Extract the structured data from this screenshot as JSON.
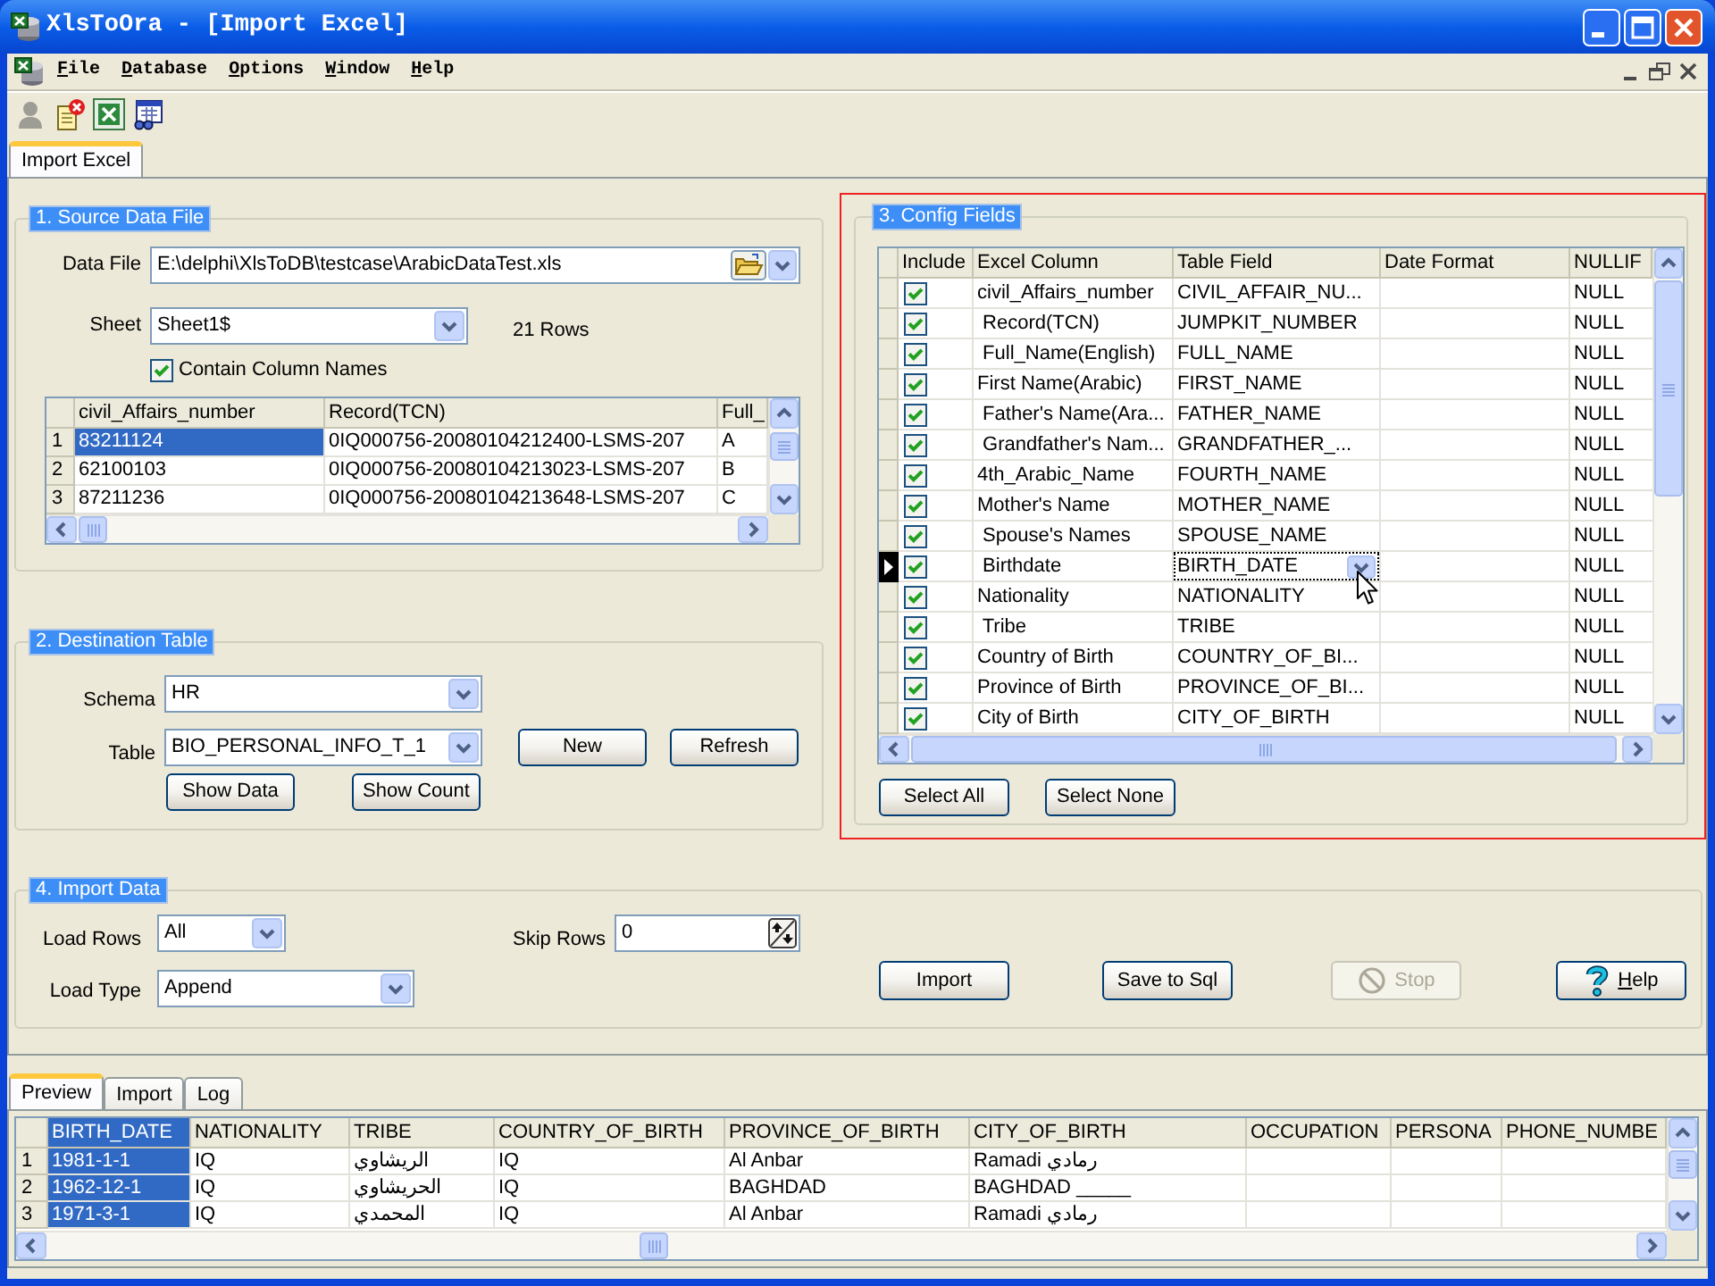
{
  "window": {
    "title": "XlsToOra - [Import Excel]"
  },
  "menu": [
    "File",
    "Database",
    "Options",
    "Window",
    "Help"
  ],
  "toolbar": [
    {
      "disabled": true
    },
    {
      "disabled": false
    },
    {
      "disabled": false
    },
    {
      "disabled": false
    }
  ],
  "tabs": [
    {
      "label": "Import Excel",
      "selected": true
    }
  ],
  "source_data_file": {
    "title": "1. Source Data File",
    "data_file": {
      "label": "Data File",
      "value": "E:\\delphi\\XlsToDB\\testcase\\ArabicDataTest.xls"
    },
    "sheet": {
      "label": "Sheet",
      "value": "Sheet1$"
    },
    "row_count": "21 Rows",
    "contain_column_names": {
      "label": "Contain Column Names",
      "checked": true
    },
    "grid": {
      "columns": [
        {
          "label": "civil_Affairs_number",
          "selected": true
        },
        {
          "label": "Record(TCN)",
          "selected": false
        },
        {
          "label": "Full_",
          "selected": false
        }
      ],
      "rows": [
        {
          "number": "1",
          "selected": true,
          "cells": [
            "83211124",
            "0IQ000756-20080104212400-LSMS-207",
            "A"
          ]
        },
        {
          "number": "2",
          "selected": false,
          "cells": [
            "62100103",
            "0IQ000756-20080104213023-LSMS-207",
            "B"
          ]
        },
        {
          "number": "3",
          "selected": false,
          "cells": [
            "87211236",
            "0IQ000756-20080104213648-LSMS-207",
            "C"
          ]
        }
      ]
    }
  },
  "destination_table": {
    "title": "2. Destination Table",
    "schema": {
      "label": "Schema",
      "value": "HR"
    },
    "table": {
      "label": "Table",
      "value": "BIO_PERSONAL_INFO_T_1"
    },
    "buttons": [
      "New",
      "Refresh",
      "Show Data",
      "Show Count"
    ]
  },
  "config_fields": {
    "title": "3. Config Fields",
    "highlighted": true,
    "columns": [
      "Include",
      "Excel Column",
      "Table Field",
      "Date Format",
      "NULLIF"
    ],
    "rows": [
      {
        "include": true,
        "excel_column": "civil_Affairs_number",
        "table_field": "CIVIL_AFFAIR_NU...",
        "nullif": "NULL",
        "selected": false
      },
      {
        "include": true,
        "excel_column": " Record(TCN)",
        "table_field": "JUMPKIT_NUMBER",
        "nullif": "NULL",
        "selected": false
      },
      {
        "include": true,
        "excel_column": " Full_Name(English)",
        "table_field": "FULL_NAME",
        "nullif": "NULL",
        "selected": false
      },
      {
        "include": true,
        "excel_column": "First Name(Arabic)",
        "table_field": "FIRST_NAME",
        "nullif": "NULL",
        "selected": false
      },
      {
        "include": true,
        "excel_column": " Father's Name(Ara...",
        "table_field": "FATHER_NAME",
        "nullif": "NULL",
        "selected": false
      },
      {
        "include": true,
        "excel_column": " Grandfather's Nam...",
        "table_field": "GRANDFATHER_...",
        "nullif": "NULL",
        "selected": false
      },
      {
        "include": true,
        "excel_column": "4th_Arabic_Name",
        "table_field": "FOURTH_NAME",
        "nullif": "NULL",
        "selected": false
      },
      {
        "include": true,
        "excel_column": "Mother's Name",
        "table_field": "MOTHER_NAME",
        "nullif": "NULL",
        "selected": false
      },
      {
        "include": true,
        "excel_column": " Spouse's Names",
        "table_field": "SPOUSE_NAME",
        "nullif": "NULL",
        "selected": false
      },
      {
        "include": true,
        "excel_column": " Birthdate",
        "table_field": "BIRTH_DATE",
        "nullif": "NULL",
        "selected": true
      },
      {
        "include": true,
        "excel_column": "Nationality",
        "table_field": "NATIONALITY",
        "nullif": "NULL",
        "selected": false
      },
      {
        "include": true,
        "excel_column": " Tribe",
        "table_field": "TRIBE",
        "nullif": "NULL",
        "selected": false
      },
      {
        "include": true,
        "excel_column": "Country of Birth",
        "table_field": "COUNTRY_OF_BI...",
        "nullif": "NULL",
        "selected": false
      },
      {
        "include": true,
        "excel_column": "Province of Birth",
        "table_field": "PROVINCE_OF_BI...",
        "nullif": "NULL",
        "selected": false
      },
      {
        "include": true,
        "excel_column": "City of Birth",
        "table_field": "CITY_OF_BIRTH",
        "nullif": "NULL",
        "selected": false
      }
    ],
    "buttons": [
      "Select All",
      "Select None"
    ]
  },
  "import_data": {
    "title": "4. Import Data",
    "load_rows": {
      "label": "Load Rows",
      "value": "All"
    },
    "skip_rows": {
      "label": "Skip Rows",
      "value": "0"
    },
    "load_type": {
      "label": "Load Type",
      "value": "Append"
    },
    "buttons": [
      {
        "kind": "plain",
        "label": "Import",
        "disabled": false
      },
      {
        "kind": "plain",
        "label": "Save to Sql",
        "disabled": false
      },
      {
        "kind": "stop",
        "label": "Stop",
        "disabled": true
      },
      {
        "kind": "help",
        "label": "Help",
        "disabled": false
      }
    ]
  },
  "result_tabs": [
    {
      "label": "Preview",
      "selected": true
    },
    {
      "label": "Import",
      "selected": false
    },
    {
      "label": "Log",
      "selected": false
    }
  ],
  "preview_grid": {
    "columns": [
      {
        "label": "BIRTH_DATE",
        "selected": true
      },
      {
        "label": "NATIONALITY",
        "selected": false
      },
      {
        "label": "TRIBE",
        "selected": false
      },
      {
        "label": "COUNTRY_OF_BIRTH",
        "selected": false
      },
      {
        "label": "PROVINCE_OF_BIRTH",
        "selected": false
      },
      {
        "label": "CITY_OF_BIRTH",
        "selected": false
      },
      {
        "label": "OCCUPATION",
        "selected": false
      },
      {
        "label": "PERSONA",
        "selected": false
      },
      {
        "label": "PHONE_NUMBE",
        "selected": false
      }
    ],
    "rows": [
      {
        "number": "1",
        "cells": [
          "1981-1-1",
          "IQ",
          "الريشاوي",
          "IQ",
          "Al Anbar",
          "Ramadi رمادي"
        ]
      },
      {
        "number": "2",
        "cells": [
          "1962-12-1",
          "IQ",
          "الحريشاوي",
          "IQ",
          "BAGHDAD",
          "BAGHDAD _____"
        ]
      },
      {
        "number": "3",
        "cells": [
          "1971-3-1",
          "IQ",
          "المحمدي",
          "IQ",
          "Al Anbar",
          "Ramadi رمادي"
        ]
      }
    ]
  }
}
